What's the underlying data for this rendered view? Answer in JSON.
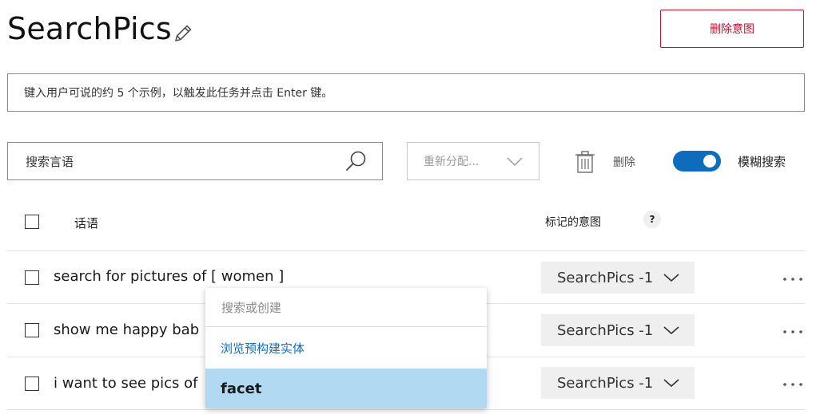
{
  "header": {
    "title": "SearchPics",
    "delete_intent_label": "删除意图"
  },
  "example_input": {
    "placeholder": "键入用户可说的约 5 个示例，以触发此任务并点击 Enter 键。"
  },
  "toolbar": {
    "search_placeholder": "搜索言语",
    "reassign_label": "重新分配...",
    "delete_label": "删除",
    "fuzzy_label": "模糊搜索",
    "fuzzy_on": true
  },
  "table": {
    "col_utterance": "话语",
    "col_intent": "标记的意图",
    "help_glyph": "?",
    "rows": [
      {
        "utterance": "search for pictures of [ women ]",
        "intent": "SearchPics -1"
      },
      {
        "utterance": "show me happy bab",
        "intent": "SearchPics -1"
      },
      {
        "utterance": "i want to see pics of",
        "intent": "SearchPics -1"
      }
    ]
  },
  "entity_popup": {
    "search_placeholder": "搜索或创建",
    "browse_label": "浏览预构建实体",
    "selected_item": "facet"
  },
  "colors": {
    "accent": "#0f6cbd",
    "danger": "#c8102e",
    "highlight": "#b1daf2"
  }
}
